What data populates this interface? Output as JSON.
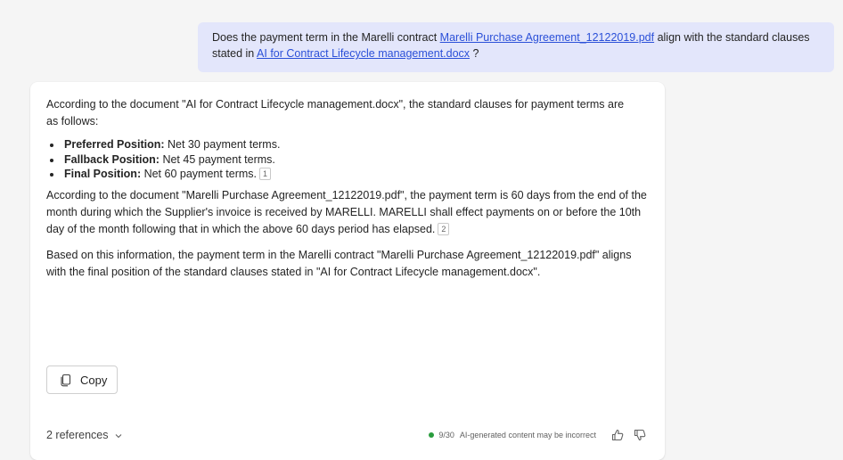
{
  "user_message": {
    "prefix": "Does the payment term in the Marelli contract ",
    "link1": "Marelli Purchase Agreement_12122019.pdf",
    "middle": " align with the standard clauses stated in ",
    "link2": "AI for Contract Lifecycle management.docx",
    "suffix": " ?"
  },
  "response": {
    "intro": "According to the document \"AI for Contract Lifecycle management.docx\", the standard clauses for payment terms are as follows:",
    "bullets": [
      {
        "label": "Preferred Position:",
        "text": " Net 30 payment terms."
      },
      {
        "label": "Fallback Position:",
        "text": " Net 45 payment terms."
      },
      {
        "label": "Final Position:",
        "text": " Net 60 payment terms.",
        "ref": "1"
      }
    ],
    "paragraph2": "According to the document \"Marelli Purchase Agreement_12122019.pdf\", the payment term is 60 days from the end of the month during which the Supplier's invoice is received by MARELLI. MARELLI shall effect payments on or before the 10th day of the month following that in which the above 60 days period has elapsed.",
    "paragraph2_ref": "2",
    "paragraph3": "Based on this information, the payment term in the Marelli contract \"Marelli Purchase Agreement_12122019.pdf\" aligns with the final position of the standard clauses stated in \"AI for Contract Lifecycle management.docx\"."
  },
  "actions": {
    "copy_label": "Copy",
    "copy_icon": "copy-icon"
  },
  "footer": {
    "references_label": "2 references",
    "counter": "9/30",
    "disclaimer": "AI-generated content may be incorrect",
    "status_color": "#2a9d3e"
  },
  "colors": {
    "link": "#2b50d8",
    "user_bubble": "#e3e6fb",
    "background": "#f5f5f5"
  }
}
